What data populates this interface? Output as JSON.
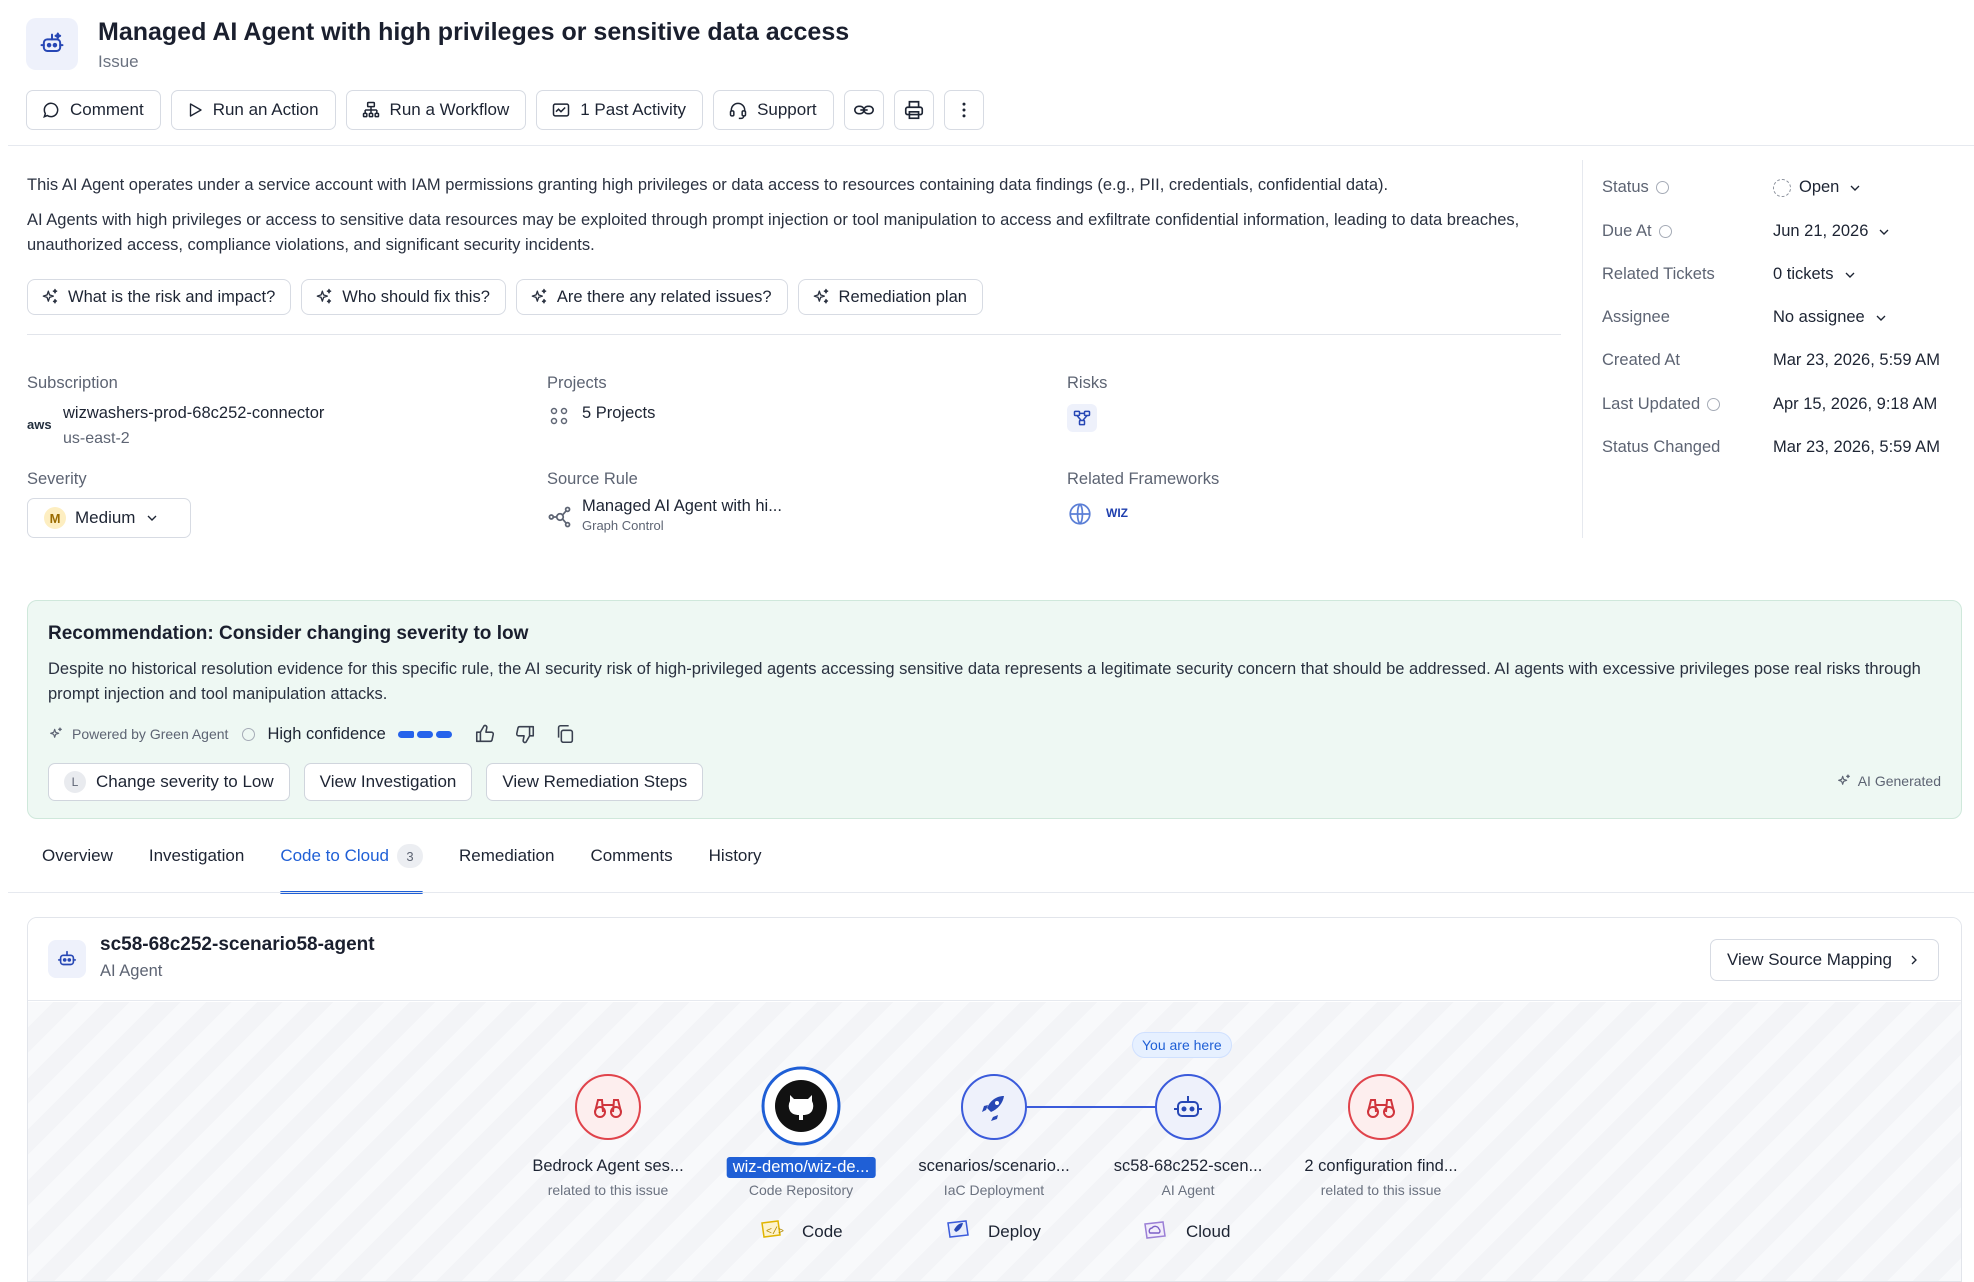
{
  "header": {
    "title": "Managed AI Agent with high privileges or sensitive data access",
    "subtitle": "Issue",
    "icon": "ai-agent-icon"
  },
  "toolbar": {
    "comment": "Comment",
    "run_action": "Run an Action",
    "run_workflow": "Run a Workflow",
    "past_activity": "1 Past Activity",
    "support": "Support"
  },
  "description": {
    "line1": "This AI Agent operates under a service account with IAM permissions granting high privileges or data access to resources containing data findings (e.g., PII, credentials, confidential data).",
    "line2": "AI Agents with high privileges or access to sensitive data resources may be exploited through prompt injection or tool manipulation to access and exfiltrate confidential information, leading to data breaches, unauthorized access, compliance violations, and significant security incidents."
  },
  "prompts": [
    "What is the risk and impact?",
    "Who should fix this?",
    "Are there any related issues?",
    "Remediation plan"
  ],
  "fields": {
    "subscription_label": "Subscription",
    "subscription_provider": "aws",
    "subscription_value": "wizwashers-prod-68c252-connector",
    "subscription_region": "us-east-2",
    "projects_label": "Projects",
    "projects_value": "5 Projects",
    "risks_label": "Risks",
    "severity_label": "Severity",
    "severity_badge": "M",
    "severity_value": "Medium",
    "source_rule_label": "Source Rule",
    "source_rule_value": "Managed AI Agent with hi...",
    "source_rule_sub": "Graph Control",
    "frameworks_label": "Related Frameworks",
    "frameworks_value": "WIZ"
  },
  "side_panel": {
    "status_label": "Status",
    "status_value": "Open",
    "due_label": "Due At",
    "due_value": "Jun 21, 2026",
    "tickets_label": "Related Tickets",
    "tickets_value": "0 tickets",
    "assignee_label": "Assignee",
    "assignee_value": "No assignee",
    "created_label": "Created At",
    "created_value": "Mar 23, 2026, 5:59 AM",
    "updated_label": "Last Updated",
    "updated_value": "Apr 15, 2026, 9:18 AM",
    "status_changed_label": "Status Changed",
    "status_changed_value": "Mar 23, 2026, 5:59 AM"
  },
  "recommendation": {
    "title": "Recommendation: Consider changing severity to low",
    "body": "Despite no historical resolution evidence for this specific rule, the AI security risk of high-privileged agents accessing sensitive data represents a legitimate security concern that should be addressed. AI agents with excessive privileges pose real risks through prompt injection and tool manipulation attacks.",
    "powered_by": "Powered by Green Agent",
    "confidence": "High confidence",
    "change_badge": "L",
    "change_btn": "Change severity to Low",
    "investigation_btn": "View Investigation",
    "remediation_btn": "View Remediation Steps",
    "ai_generated": "AI Generated"
  },
  "tabs": [
    {
      "label": "Overview"
    },
    {
      "label": "Investigation"
    },
    {
      "label": "Code to Cloud",
      "count": "3",
      "active": true
    },
    {
      "label": "Remediation"
    },
    {
      "label": "Comments"
    },
    {
      "label": "History"
    }
  ],
  "card": {
    "title": "sc58-68c252-scenario58-agent",
    "subtitle": "AI Agent",
    "view_source_mapping": "View Source Mapping",
    "you_are_here": "You are here"
  },
  "flow_nodes": [
    {
      "label": "Bedrock Agent ses...",
      "sub": "related to this issue",
      "icon": "binoculars-icon"
    },
    {
      "label": "wiz-demo/wiz-de...",
      "sub": "Code Repository",
      "icon": "github-icon"
    },
    {
      "label": "scenarios/scenario...",
      "sub": "IaC Deployment",
      "icon": "rocket-icon"
    },
    {
      "label": "sc58-68c252-scen...",
      "sub": "AI Agent",
      "icon": "ai-agent-icon"
    },
    {
      "label": "2 configuration find...",
      "sub": "related to this issue",
      "icon": "binoculars-icon"
    }
  ],
  "stages": {
    "code": "Code",
    "deploy": "Deploy",
    "cloud": "Cloud"
  },
  "colors": {
    "accent": "#1f5fd6",
    "finding_red": "#e0434b",
    "recommendation_bg": "#eef8f3"
  }
}
